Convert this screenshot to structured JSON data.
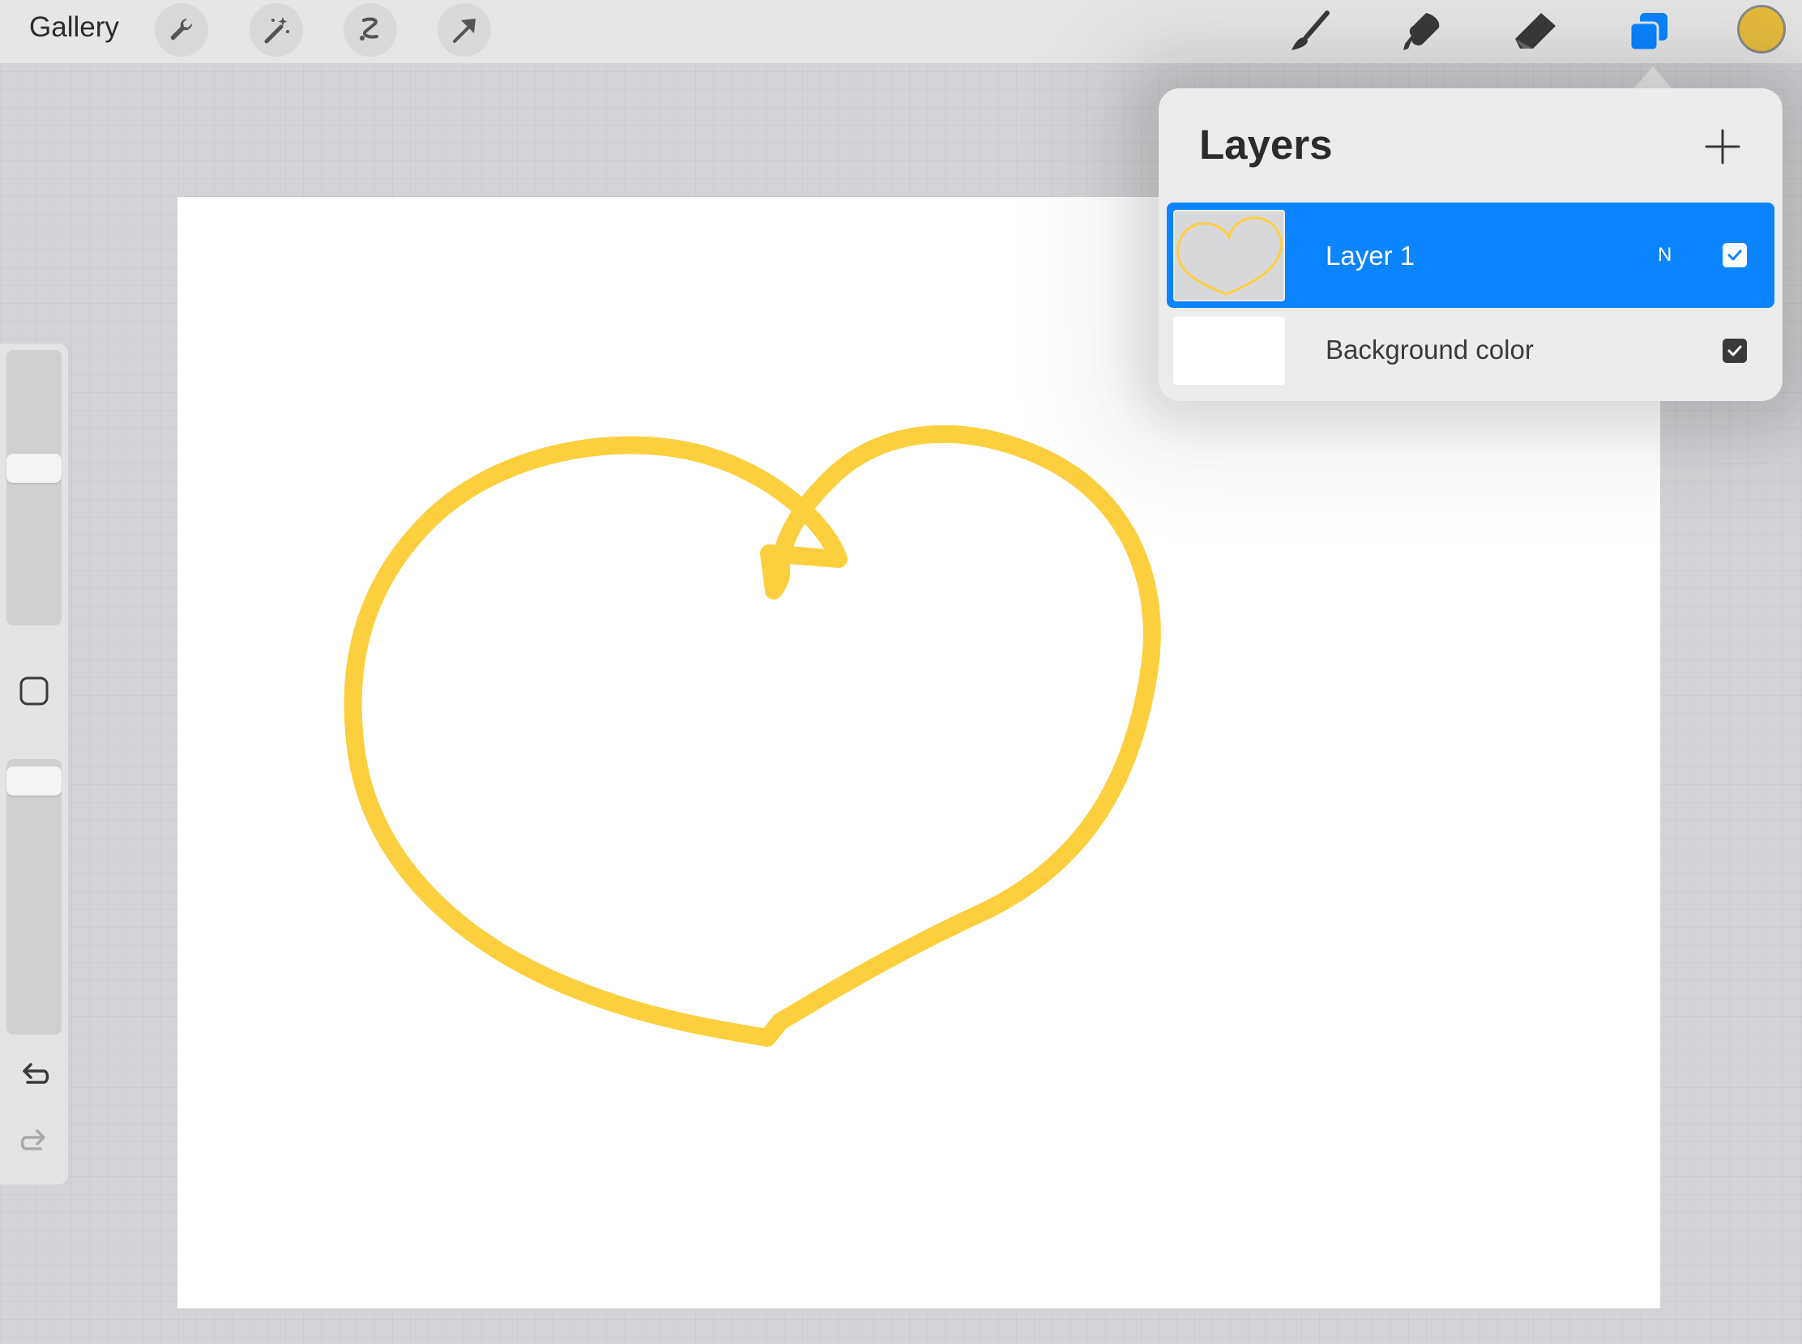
{
  "toolbar": {
    "gallery_label": "Gallery",
    "left_tools": [
      "wrench-icon",
      "magic-wand-icon",
      "selection-icon",
      "transform-arrow-icon"
    ],
    "right_tools": [
      "brush-icon",
      "smudge-icon",
      "eraser-icon",
      "layers-icon"
    ],
    "current_color": "#e6bc3c",
    "active_accent": "#0a84ff"
  },
  "sidebar": {
    "brush_size_level": 0.58,
    "opacity_level": 0.97,
    "icons": [
      "modify-square-icon",
      "undo-icon",
      "redo-icon"
    ]
  },
  "canvas": {
    "stroke_color": "#fccf3f",
    "drawing": "heart-outline"
  },
  "layers_panel": {
    "title": "Layers",
    "add_icon": "plus-icon",
    "layers": [
      {
        "name": "Layer 1",
        "blend_mode": "N",
        "visible": true,
        "selected": true
      },
      {
        "name": "Background color",
        "visible": true,
        "selected": false
      }
    ]
  }
}
